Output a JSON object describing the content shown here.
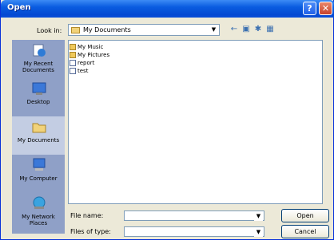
{
  "window": {
    "title": "Open",
    "help_glyph": "?",
    "close_glyph": "✕"
  },
  "lookin": {
    "label": "Look in:",
    "value": "My Documents"
  },
  "places": [
    {
      "label": "My Recent Documents"
    },
    {
      "label": "Desktop"
    },
    {
      "label": "My Documents"
    },
    {
      "label": "My Computer"
    },
    {
      "label": "My Network Places"
    }
  ],
  "files": [
    {
      "name": "My Music",
      "icon": "folder-icon"
    },
    {
      "name": "My Pictures",
      "icon": "folder-icon"
    },
    {
      "name": "report",
      "icon": "document-icon"
    },
    {
      "name": "test",
      "icon": "document-icon"
    }
  ],
  "filename": {
    "label": "File name:",
    "value": ""
  },
  "filetype": {
    "label": "Files of type:",
    "value": ""
  },
  "buttons": {
    "open": "Open",
    "cancel": "Cancel"
  }
}
